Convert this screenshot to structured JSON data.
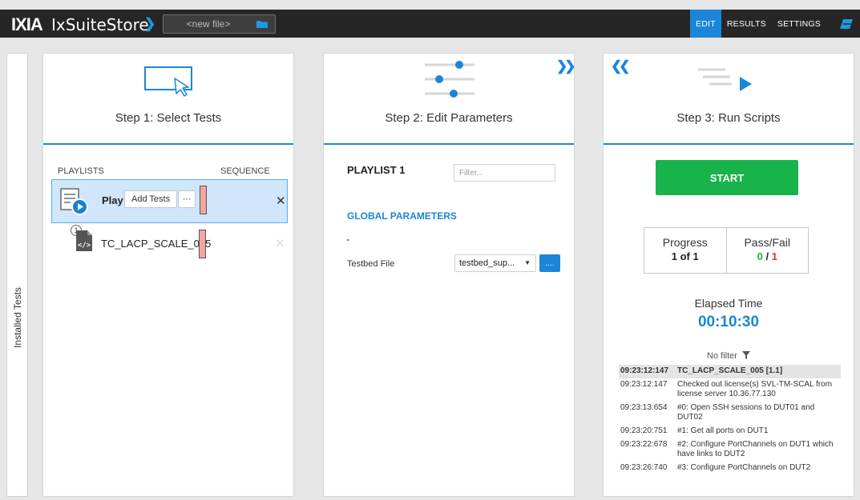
{
  "header": {
    "logo": "IXIA",
    "app_title": "IxSuiteStore",
    "file_placeholder": "<new file>",
    "nav": [
      "EDIT",
      "RESULTS",
      "SETTINGS"
    ],
    "active_nav": "EDIT",
    "accent": "#1b86d8"
  },
  "rail": {
    "label": "Installed Tests"
  },
  "step1": {
    "title": "Step 1: Select Tests",
    "playlists_label": "PLAYLISTS",
    "sequence_label": "SEQUENCE",
    "playlist": {
      "name": "Play",
      "add_label": "Add Tests",
      "more_label": "···",
      "close": "✕"
    },
    "tests": [
      {
        "index": "1",
        "name": "TC_LACP_SCALE_005",
        "close": "✕"
      }
    ]
  },
  "step2": {
    "title": "Step 2: Edit Parameters",
    "playlist_title": "PLAYLIST 1",
    "filter_placeholder": "Filter...",
    "global_params": "GLOBAL PARAMETERS",
    "params": [
      {
        "label": "Testbed File",
        "value": "testbed_sup...",
        "browse": "...."
      }
    ]
  },
  "step3": {
    "title": "Step 3: Run Scripts",
    "start_label": "START",
    "progress_label": "Progress",
    "progress_value": "1 of 1",
    "passfail_label": "Pass/Fail",
    "pass_count": "0",
    "separator": "/",
    "fail_count": "1",
    "elapsed_label": "Elapsed Time",
    "elapsed_value": "00:10:30",
    "filter_label": "No filter",
    "log": [
      {
        "time": "09:23:12:147",
        "msg": "TC_LACP_SCALE_005 [1.1]",
        "highlight": true
      },
      {
        "time": "09:23:12:147",
        "msg": "Checked out license(s) SVL-TM-SCAL from license server 10.36.77.130"
      },
      {
        "time": "09:23:13:654",
        "msg": "#0: Open SSH sessions to DUT01 and DUT02"
      },
      {
        "time": "09:23:20:751",
        "msg": "#1: Get all ports on DUT1"
      },
      {
        "time": "09:23:22:678",
        "msg": "#2: Configure PortChannels on DUT1 which have links to DUT2"
      },
      {
        "time": "09:23:26:740",
        "msg": "#3: Configure PortChannels on DUT2"
      }
    ],
    "colors": {
      "start": "#19b34b",
      "pass": "#19b34b",
      "fail": "#e0302c"
    }
  }
}
